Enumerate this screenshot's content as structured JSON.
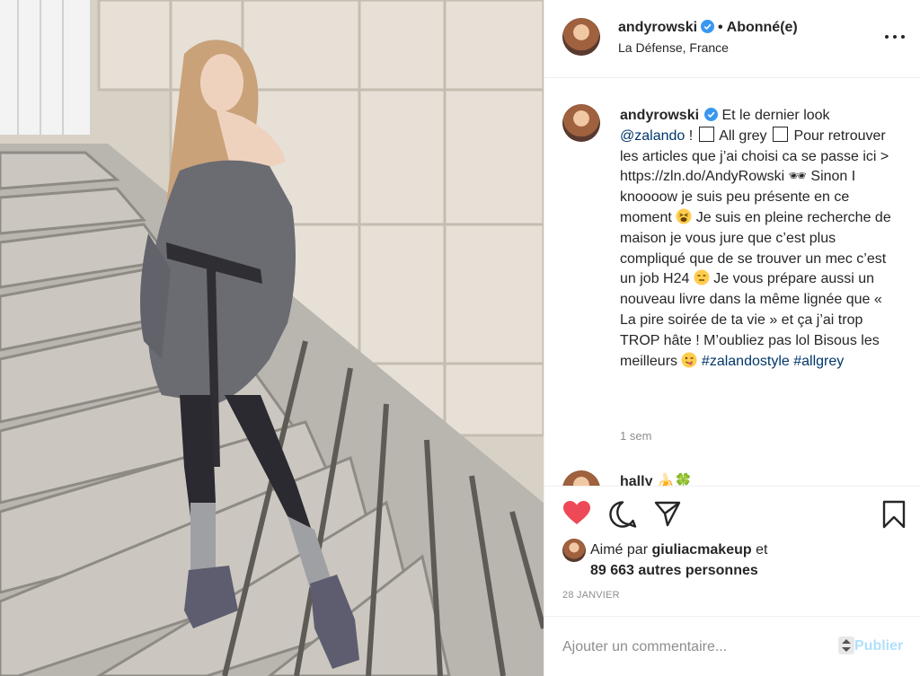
{
  "post": {
    "author": "andyrowski",
    "follow_status": "Abonné(e)",
    "location": "La Défense, France",
    "photo_alt_icon": "fashion-photo"
  },
  "caption": {
    "username": "andyrowski",
    "text_1": "Et le dernier look",
    "mention": "@zalando",
    "text_2": " ! ",
    "text_3": " All grey ",
    "text_4": " Pour retrouver les articles que j’ai choisi ca se passe ici > https://zln.do/AndyRowski ",
    "emoji_1": "🕶",
    "text_5": " Sinon I knoooow je suis peu présente en ce moment ",
    "text_6": " Je suis en pleine recherche de maison je vous jure que c’est plus compliqué que de se trouver un mec c’est un job H24 ",
    "text_7": " Je vous prépare aussi un nouveau livre dans la même lignée que « La pire soirée de ta vie » et ça j’ai trop TROP hâte ! M’oubliez pas lol Bisous les meilleurs ",
    "hashtag_1": "#zalandostyle",
    "hashtag_2": "#allgrey",
    "time_ago": "1 sem"
  },
  "reply": {
    "username": "hally",
    "emoji": "🍌🍀"
  },
  "actions": {
    "liked_prefix": "Aimé par",
    "liked_user": "giuliacmakeup",
    "liked_and": "et",
    "liked_count": "89 663 autres personnes",
    "date": "28 JANVIER"
  },
  "comment_box": {
    "placeholder": "Ajouter un commentaire...",
    "publish_label": "Publier"
  },
  "colors": {
    "like_red": "#ed4956",
    "verified_blue": "#3897f0",
    "link_blue": "#00376b",
    "publish_disabled": "#b2dffc"
  }
}
